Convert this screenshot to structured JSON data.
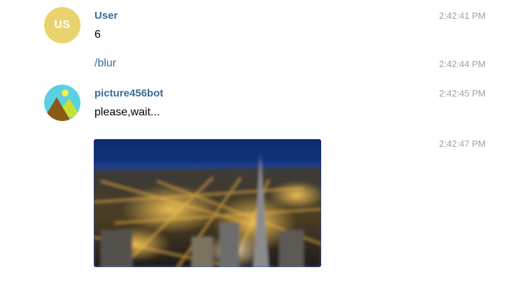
{
  "messages": [
    {
      "sender": "User",
      "avatar_initials": "US",
      "avatar_color": "#e9d36f",
      "text": "6",
      "time": "2:42:41 PM"
    },
    {
      "text": "/blur",
      "time": "2:42:44 PM"
    },
    {
      "sender": "picture456bot",
      "avatar_icon": "mountain-sun-icon",
      "text": "please,wait...",
      "time": "2:42:45 PM"
    },
    {
      "photo": "blurred-city-night-photo",
      "time": "2:42:47 PM"
    }
  ],
  "colors": {
    "sender_name": "#3a6d99",
    "timestamp": "#a0a0a0",
    "user_avatar": "#e9d36f",
    "bot_avatar_bg": "#5bd0e0"
  }
}
